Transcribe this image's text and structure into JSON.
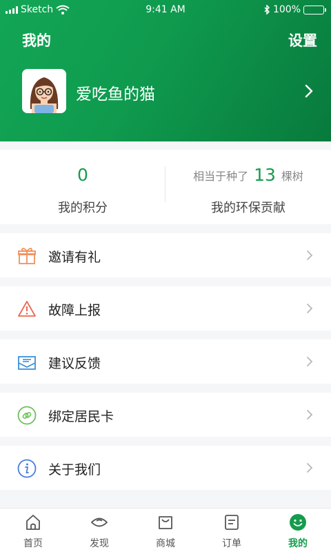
{
  "status_bar": {
    "carrier": "Sketch",
    "time": "9:41 AM",
    "battery": "100%"
  },
  "header": {
    "title": "我的",
    "settings": "设置",
    "username": "爱吃鱼的猫"
  },
  "stats": {
    "points_value": "0",
    "points_label": "我的积分",
    "equiv_prefix": "相当于种了",
    "equiv_value": "13",
    "equiv_suffix": "棵树",
    "contribution_label": "我的环保贡献"
  },
  "menu": [
    {
      "label": "邀请有礼",
      "icon": "gift-icon",
      "color": "#f0905c"
    },
    {
      "label": "故障上报",
      "icon": "warning-icon",
      "color": "#e8694f"
    },
    {
      "label": "建议反馈",
      "icon": "feedback-mail-icon",
      "color": "#3a8fd9"
    },
    {
      "label": "绑定居民卡",
      "icon": "link-icon",
      "color": "#6cc05a"
    },
    {
      "label": "关于我们",
      "icon": "info-icon",
      "color": "#4a7cd8"
    }
  ],
  "tabs": [
    {
      "label": "首页",
      "icon": "home-icon"
    },
    {
      "label": "发现",
      "icon": "eye-icon"
    },
    {
      "label": "商城",
      "icon": "shop-bag-icon"
    },
    {
      "label": "订单",
      "icon": "order-list-icon"
    },
    {
      "label": "我的",
      "icon": "smile-icon",
      "active": true
    }
  ],
  "colors": {
    "brand": "#159c4d",
    "background": "#f5f6f8"
  }
}
